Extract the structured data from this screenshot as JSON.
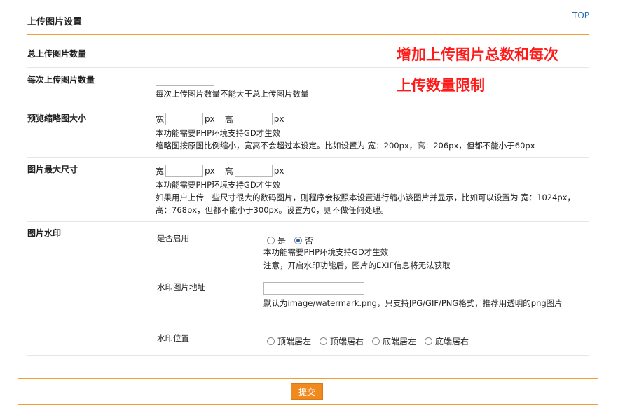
{
  "header": {
    "title": "上传图片设置",
    "top_link": "TOP"
  },
  "annotation": {
    "line1": "增加上传图片总数和每次",
    "line2": "上传数量限制"
  },
  "total_upload": {
    "label": "总上传图片数量",
    "value": ""
  },
  "per_upload": {
    "label": "每次上传图片数量",
    "value": "",
    "hint": "每次上传图片数量不能大于总上传图片数量"
  },
  "preview_thumb": {
    "label": "预览缩略图大小",
    "width_label": "宽",
    "height_label": "高",
    "unit": "px",
    "width_value": "",
    "height_value": "",
    "hint1": "本功能需要PHP环境支持GD才生效",
    "hint2": "缩略图按原图比例缩小，宽高不会超过本设定。比如设置为 宽：200px，高：206px，但都不能小于60px"
  },
  "max_size": {
    "label": "图片最大尺寸",
    "width_label": "宽",
    "height_label": "高",
    "unit": "px",
    "width_value": "",
    "height_value": "",
    "hint1": "本功能需要PHP环境支持GD才生效",
    "hint2": "如果用户上传一些尺寸很大的数码图片，则程序会按照本设置进行缩小该图片并显示，比如可以设置为 宽：1024px，高：768px，但都不能小于300px。设置为0，则不做任何处理。"
  },
  "watermark": {
    "label": "图片水印",
    "enable_label": "是否启用",
    "yes_label": "是",
    "no_label": "否",
    "selected": "否",
    "enable_hint1": "本功能需要PHP环境支持GD才生效",
    "enable_hint2": "注意，开启水印功能后，图片的EXIF信息将无法获取",
    "image_label": "水印图片地址",
    "image_value": "",
    "image_hint": "默认为image/watermark.png，只支持JPG/GIF/PNG格式，推荐用透明的png图片",
    "position_label": "水印位置",
    "positions": [
      "顶端居左",
      "顶端居右",
      "底端居左",
      "底端居右"
    ]
  },
  "footer": {
    "submit_label": "提交"
  },
  "colors": {
    "accent": "#f0a030",
    "button": "#f08a1e",
    "annotation": "#ff1a1a",
    "link": "#2a6bb0"
  }
}
